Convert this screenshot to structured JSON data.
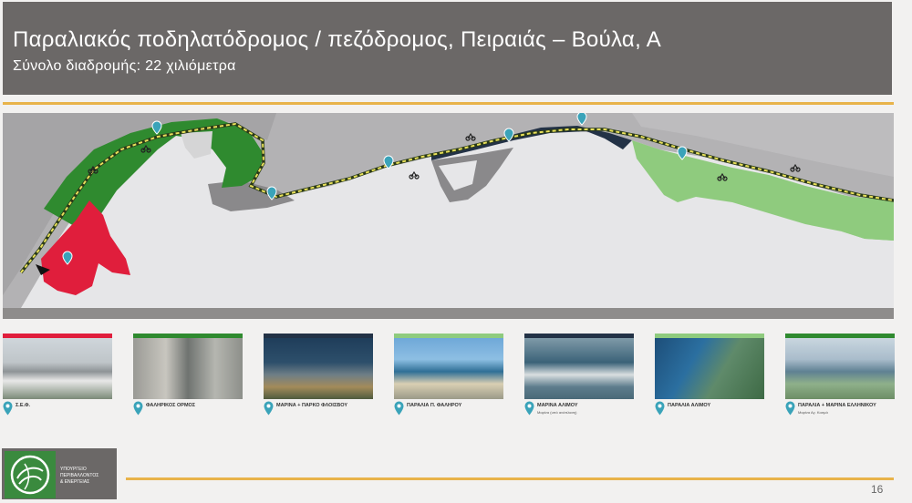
{
  "header": {
    "title": "Παραλιακός ποδηλατόδρομος / πεζόδρομος, Πειραιάς – Βούλα, Α",
    "subtitle": "Σύνολο διαδρομής: 22 χιλιόμετρα"
  },
  "colors": {
    "header_bg": "#6b6867",
    "gold": "#e8b34a",
    "dark_green": "#2f8a2f",
    "light_green": "#8fcb7e",
    "red": "#e01e3c",
    "navy": "#233246",
    "route_yellow": "#e8e05a",
    "pin_teal": "#3aa3b9"
  },
  "map": {
    "icons": [
      "location-pin-icon",
      "cyclist-icon"
    ]
  },
  "thumbnails": [
    {
      "caption": "Σ.Ε.Φ.",
      "sub": "",
      "bar_color": "#e01e3c"
    },
    {
      "caption": "ΦΑΛΗΡΙΚΟΣ ΟΡΜΟΣ",
      "sub": "",
      "bar_color": "#2f8a2f"
    },
    {
      "caption": "ΜΑΡΙΝΑ + ΠΑΡΚΟ ΦΛΟΙΣΒΟΥ",
      "sub": "",
      "bar_color": "#233246"
    },
    {
      "caption": "ΠΑΡΑΛΙΑ Π. ΦΑΛΗΡΟΥ",
      "sub": "",
      "bar_color": "#8fcb7e"
    },
    {
      "caption": "ΜΑΡΙΝΑ ΑΛΙΜΟΥ",
      "sub": "Μαρίνα (υπό ανάπλαση)",
      "bar_color": "#233246"
    },
    {
      "caption": "ΠΑΡΑΛΙΑ ΑΛΙΜΟΥ",
      "sub": "",
      "bar_color": "#8fcb7e"
    },
    {
      "caption": "ΠΑΡΑΛΙΑ + ΜΑΡΙΝΑ ΕΛΛΗΝΙΚΟΥ",
      "sub": "Μαρίνα Αγ. Κοσμά",
      "bar_color": "#2f8a2f"
    }
  ],
  "footer": {
    "logo_lines": [
      "ΥΠΟΥΡΓΕΙΟ",
      "ΠΕΡΙΒΑΛΛΟΝΤΟΣ",
      "& ΕΝΕΡΓΕΙΑΣ"
    ],
    "page_number": "16"
  }
}
